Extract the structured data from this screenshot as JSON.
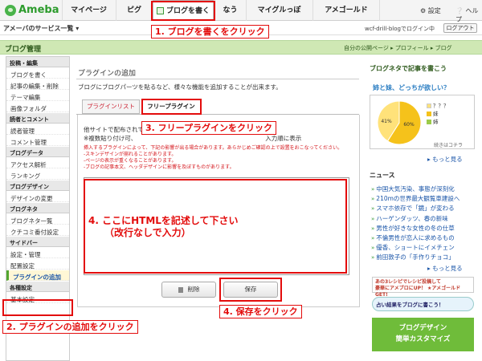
{
  "topbar": {
    "logo": "Ameba",
    "nav": [
      "マイページ",
      "ピグ",
      "ブログを書く",
      "なう",
      "マイグルっぽ",
      "アメゴールド"
    ],
    "settings": "⚙ 設定",
    "help": "❔ ヘルプ"
  },
  "subbar": {
    "services": "アメーバのサービス一覧 ▾",
    "login": "wcf-drill-blogでログイン中",
    "logout": "ログアウト"
  },
  "mgmt": {
    "title": "ブログ管理",
    "links": "自分の公開ページ ▸ プロフィール ▸ ブログ"
  },
  "sidebar": {
    "items": [
      {
        "type": "head",
        "label": "投稿・編集"
      },
      {
        "type": "item",
        "label": "ブログを書く"
      },
      {
        "type": "item",
        "label": "記事の編集・削除"
      },
      {
        "type": "item",
        "label": "テーマ編集"
      },
      {
        "type": "item",
        "label": "画像フォルダ"
      },
      {
        "type": "head",
        "label": "読者とコメント"
      },
      {
        "type": "item",
        "label": "読者管理"
      },
      {
        "type": "item",
        "label": "コメント管理"
      },
      {
        "type": "head",
        "label": "ブログデータ"
      },
      {
        "type": "item",
        "label": "アクセス解析"
      },
      {
        "type": "item",
        "label": "ランキング"
      },
      {
        "type": "head",
        "label": "ブログデザイン"
      },
      {
        "type": "item",
        "label": "デザインの変更"
      },
      {
        "type": "head",
        "label": "ブログネタ"
      },
      {
        "type": "item",
        "label": "ブログネタ一覧"
      },
      {
        "type": "item",
        "label": "クチコミ番付設定"
      },
      {
        "type": "head",
        "label": "サイドバー"
      },
      {
        "type": "item",
        "label": "設定・管理"
      },
      {
        "type": "item",
        "label": "配置設定"
      },
      {
        "type": "item",
        "label": "プラグインの追加"
      },
      {
        "type": "head",
        "label": "各種設定"
      },
      {
        "type": "item",
        "label": "基本設定"
      }
    ]
  },
  "main": {
    "title": "プラグインの追加",
    "desc": "ブログにブログパーツを貼るなど、様々な機能を追加することが出来ます。",
    "tabs": [
      "プラグインリスト",
      "フリープラグイン"
    ],
    "body_line1": "他サイトで配布されて",
    "body_line2": "※複数貼り付け可、",
    "body_line2_tail": "入力順に表示",
    "warn1": "挿入するプラグインによって、下記の影響が出る場合があります。あらかじめご確認の上で設置をおこなってください。",
    "warn2": "-スキンデザインが崩れることがあります。",
    "warn3": "-ページの表示が重くなることがあります。",
    "warn4": "-ブログの記事本文、ヘッダデザインに影響を及ぼすものがあります。",
    "delete": "削除",
    "save": "保存"
  },
  "right": {
    "neta_head": "ブログネタで記事を書こう",
    "neta_q": "姉と妹、どっちが欲しい？",
    "legend": [
      "？？？",
      "妹",
      "姉"
    ],
    "neta_more": "続きはコチラ",
    "more": "▸ もっと見る",
    "news_head": "ニュース",
    "news": [
      "中国大気汚染、事態が深刻化",
      "210mの世界最大観覧車建設へ",
      "スマホ依存で「鏡」が変わる",
      "ハーゲンダッツ、春の新味",
      "男性が好きな女性の冬の仕草",
      "不倫男性が恋人に求めるもの",
      "優香、ショートにイメチェン",
      "前田敦子の「手作りチョコ」"
    ],
    "banner1": "あの3レシピでレシピ投稿して\n豪華にアメブロにUP！ ★アメゴールドGET!",
    "banner2": "占い結果をブログに書こう！",
    "banner3_1": "ブログデザイン",
    "banner3_2": "簡単カスタマイズ",
    "colors": {
      "accent": "#53a62f",
      "annotation": "#e30c0c",
      "pie_a": "#f5c21b",
      "pie_b": "#ffe27a"
    }
  },
  "chart_data": {
    "type": "pie",
    "values": [
      59,
      41
    ],
    "labels": [
      "60%",
      "41%"
    ]
  },
  "annotations": {
    "a1": "1. ブログを書くをクリック",
    "a2": "2. プラグインの追加をクリック",
    "a3": "3. フリープラグインをクリック",
    "a4a": "4. ここにHTMLを記述して下さい",
    "a4b": "（改行なしで入力）",
    "a4c": "4. 保存をクリック"
  }
}
